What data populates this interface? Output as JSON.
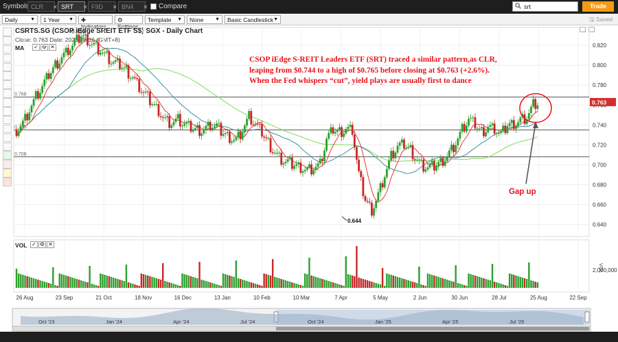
{
  "topbar": {
    "symbols_label": "Symbols:",
    "symbols": [
      {
        "label": "CLR",
        "active": false
      },
      {
        "label": "SRT",
        "active": true
      },
      {
        "label": "F9D",
        "active": false
      },
      {
        "label": "BN4",
        "active": false
      }
    ],
    "compare_label": "Compare",
    "search_value": "srt",
    "trade_label": "Trade"
  },
  "toolbar": {
    "interval": "Daily",
    "range": "1 Year",
    "indicators_label": "Indicators",
    "settings_label": "Settings",
    "template": "Template",
    "none": "None",
    "chart_style": "Basic Candlestick",
    "saved_label": "Saved"
  },
  "chart": {
    "title": "CSRTS.SG (CSOP iEdge SREIT ETF S$) SGX - Daily Chart",
    "close_text": "Close: 0.763  Date: 2025-08-26 (GMT+8)",
    "ma_label": "MA",
    "high_label": "0.836",
    "low_label": "0.644",
    "last_price_label": "0.763",
    "line_labels": [
      "0.768",
      "0.735",
      "0.708"
    ],
    "vol_label": "VOL",
    "vol_axis_label": "VOL",
    "annotation": "CSOP iEdge S-REIT Leaders ETF (SRT) traced a similar pattern,as CLR, leaping from $0.744 to a high of $0.765 before closing at $0.763 (+2.6%). When the Fed whispers “cut”, yield plays are usually first to dance",
    "gap_label": "Gap up",
    "navigator_labels": [
      "Oct '23",
      "Jan '24",
      "Apr '24",
      "Jul '24",
      "Oct '24",
      "Jan '25",
      "Apr '25",
      "Jul '25"
    ],
    "colors": {
      "up": "#2ca02c",
      "down": "#c62828",
      "ma_short": "#e53935",
      "ma_mid": "#3c8fa5",
      "ma_long": "#7ddc5a",
      "annotation": "#e8131b"
    }
  },
  "chart_data": {
    "type": "candlestick",
    "title": "CSRTS.SG (CSOP iEdge SREIT ETF S$) SGX - Daily Chart",
    "x_ticks": [
      "26 Aug",
      "23 Sep",
      "21 Oct",
      "18 Nov",
      "16 Dec",
      "13 Jan",
      "10 Feb",
      "10 Mar",
      "7 Apr",
      "5 May",
      "2 Jun",
      "30 Jun",
      "28 Jul",
      "25 Aug",
      "22 Sep"
    ],
    "y_ticks": [
      0.64,
      0.66,
      0.68,
      0.7,
      0.72,
      0.74,
      0.76,
      0.78,
      0.8,
      0.82
    ],
    "ylim": [
      0.628,
      0.838
    ],
    "vol_y_ticks": [
      "2,000,000"
    ],
    "horizontal_lines": [
      0.768,
      0.735,
      0.708
    ],
    "close_series": [
      0.735,
      0.742,
      0.755,
      0.768,
      0.778,
      0.79,
      0.8,
      0.808,
      0.815,
      0.822,
      0.83,
      0.826,
      0.82,
      0.815,
      0.808,
      0.802,
      0.8,
      0.795,
      0.788,
      0.778,
      0.77,
      0.762,
      0.755,
      0.745,
      0.742,
      0.745,
      0.74,
      0.737,
      0.735,
      0.735,
      0.74,
      0.738,
      0.732,
      0.728,
      0.725,
      0.735,
      0.748,
      0.74,
      0.732,
      0.722,
      0.712,
      0.705,
      0.702,
      0.7,
      0.698,
      0.695,
      0.697,
      0.7,
      0.725,
      0.735,
      0.733,
      0.736,
      0.735,
      0.69,
      0.665,
      0.655,
      0.67,
      0.69,
      0.708,
      0.718,
      0.72,
      0.715,
      0.705,
      0.698,
      0.697,
      0.7,
      0.705,
      0.712,
      0.722,
      0.735,
      0.745,
      0.74,
      0.733,
      0.738,
      0.736,
      0.73,
      0.74,
      0.742,
      0.745,
      0.748,
      0.76,
      0.763
    ],
    "annotations": {
      "high": 0.836,
      "low": 0.644,
      "last": 0.763
    }
  }
}
